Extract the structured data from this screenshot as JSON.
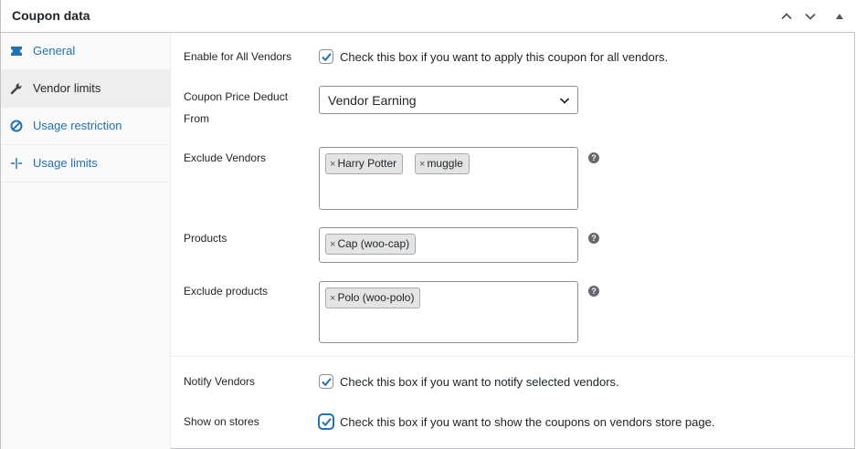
{
  "header": {
    "title": "Coupon data",
    "icons": [
      "chevron-up-icon",
      "chevron-down-icon",
      "triangle-up-icon"
    ]
  },
  "sidebar": {
    "items": [
      {
        "label": "General",
        "icon": "ticket-icon",
        "active": false
      },
      {
        "label": "Vendor limits",
        "icon": "wrench-icon",
        "active": true
      },
      {
        "label": "Usage restriction",
        "icon": "block-icon",
        "active": false
      },
      {
        "label": "Usage limits",
        "icon": "crosshair-icon",
        "active": false
      }
    ]
  },
  "fields": {
    "enable_all_vendors": {
      "label": "Enable for All Vendors",
      "checked": true,
      "description": "Check this box if you want to apply this coupon for all vendors."
    },
    "price_deduct": {
      "label_line1": "Coupon Price Deduct",
      "label_line2": "From",
      "value": "Vendor Earning"
    },
    "exclude_vendors": {
      "label": "Exclude Vendors",
      "tags": [
        "Harry Potter",
        "muggle"
      ],
      "remove_symbol": "×",
      "help": "?"
    },
    "products": {
      "label": "Products",
      "tags": [
        "Cap (woo-cap)"
      ],
      "remove_symbol": "×",
      "help": "?"
    },
    "exclude_products": {
      "label": "Exclude products",
      "tags": [
        "Polo (woo-polo)"
      ],
      "remove_symbol": "×",
      "help": "?"
    },
    "notify_vendors": {
      "label": "Notify Vendors",
      "checked": true,
      "description": "Check this box if you want to notify selected vendors."
    },
    "show_on_stores": {
      "label": "Show on stores",
      "checked": true,
      "description": "Check this box if you want to show the coupons on vendors store page."
    }
  },
  "colors": {
    "link": "#2271b1",
    "text": "#1d2327",
    "border": "#8c8f94",
    "tag_bg": "#e4e4e4"
  }
}
